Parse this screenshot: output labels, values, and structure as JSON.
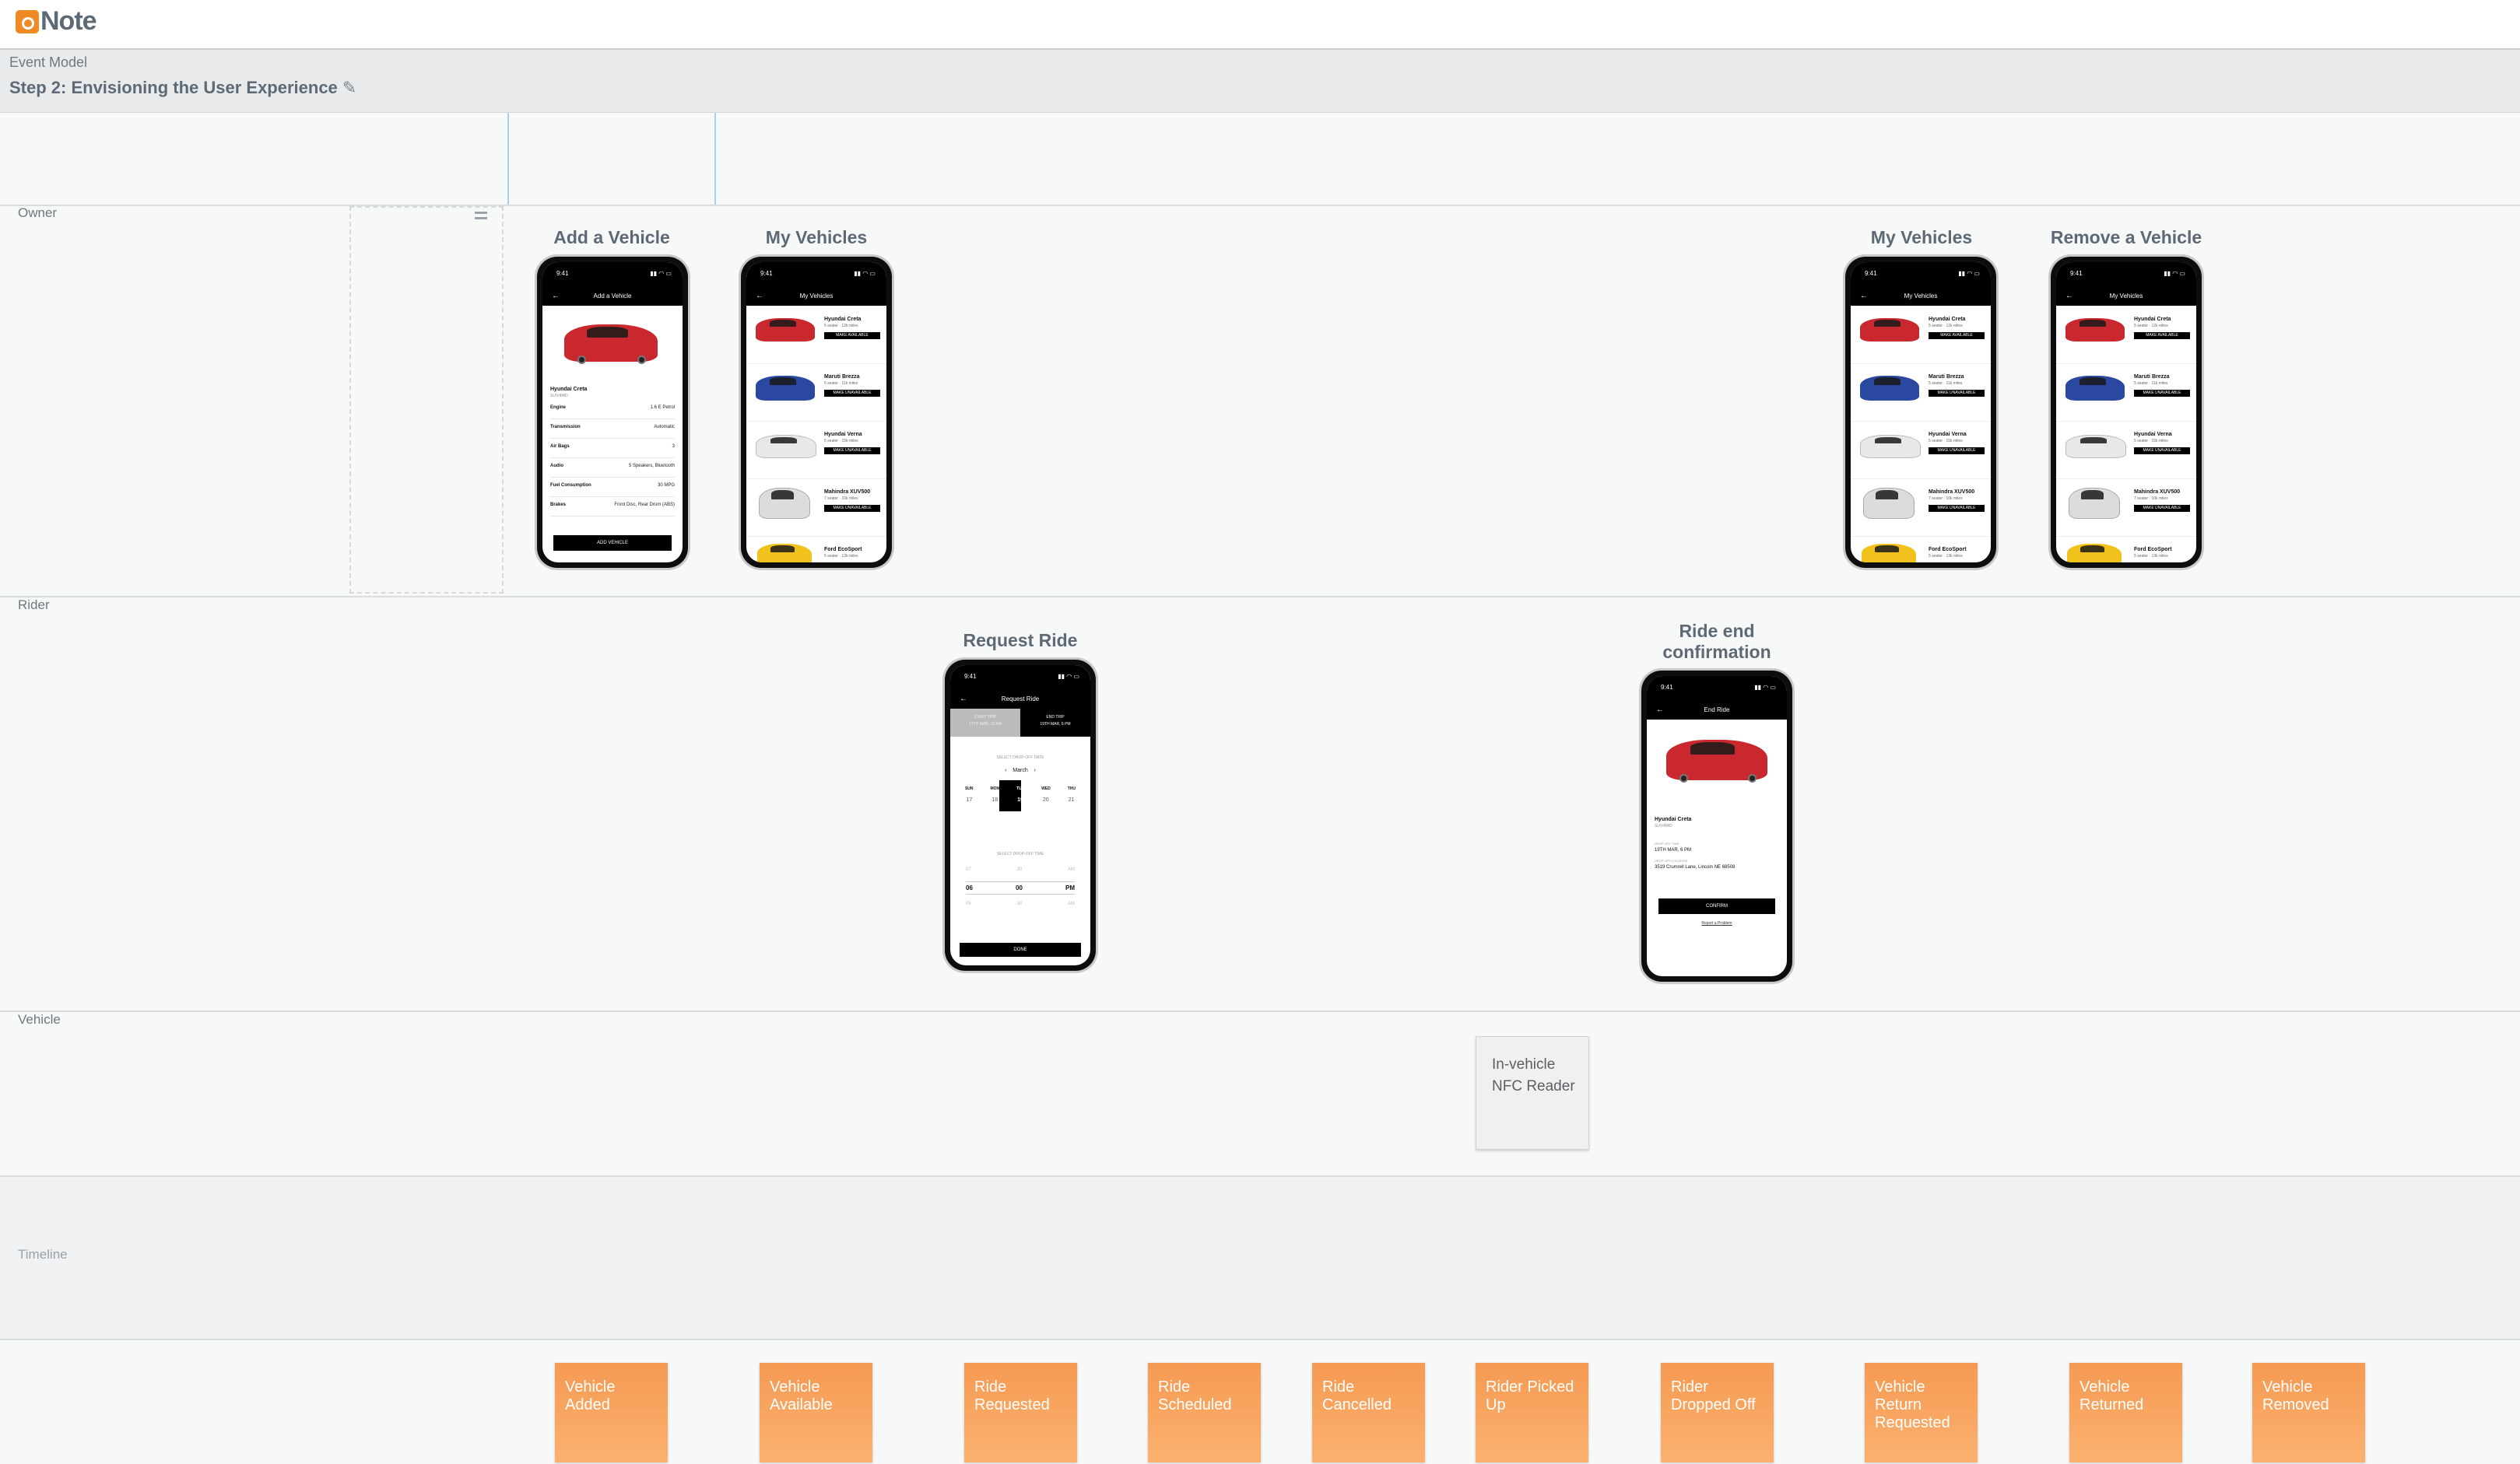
{
  "app": {
    "name": "Note"
  },
  "header": {
    "breadcrumb": "Event Model",
    "title": "Step 2: Envisioning the User Experience"
  },
  "lanes": [
    "Owner",
    "Rider",
    "Vehicle",
    "Timeline"
  ],
  "screens": {
    "add_vehicle": {
      "title": "Add a Vehicle",
      "nav_title": "Add a Vehicle",
      "status_time": "9:41",
      "car_name": "Hyundai Creta",
      "car_sub": "SUV/4WD",
      "specs": [
        {
          "k": "Engine",
          "v": "1.6 E Petrol"
        },
        {
          "k": "Transmission",
          "v": "Automatic"
        },
        {
          "k": "Air Bags",
          "v": "3"
        },
        {
          "k": "Audio",
          "v": "5 Speakers, Bluetooth"
        },
        {
          "k": "Fuel Consumption",
          "v": "30 MPG"
        },
        {
          "k": "Brakes",
          "v": "Front Disc, Rear Drum (ABS)"
        }
      ],
      "button": "ADD VEHICLE"
    },
    "my_vehicles": {
      "title": "My Vehicles",
      "nav_title": "My Vehicles",
      "status_time": "9:41",
      "vehicles": [
        {
          "name": "Hyundai Creta",
          "sub": "5 seater · 12k miles",
          "btn": "MAKE AVAILABLE"
        },
        {
          "name": "Maruti Brezza",
          "sub": "5 seater · 11k miles",
          "btn": "MAKE UNAVAILABLE"
        },
        {
          "name": "Hyundai Verna",
          "sub": "5 seater · 15k miles",
          "btn": "MAKE UNAVAILABLE"
        },
        {
          "name": "Mahindra XUV500",
          "sub": "7 seater · 10k miles",
          "btn": "MAKE UNAVAILABLE"
        },
        {
          "name": "Ford EcoSport",
          "sub": "5 seater · 13k miles",
          "btn": ""
        }
      ]
    },
    "my_vehicles_2": {
      "title": "My Vehicles"
    },
    "remove_vehicle": {
      "title": "Remove a Vehicle"
    },
    "request_ride": {
      "title": "Request Ride",
      "nav_title": "Request Ride",
      "status_time": "9:41",
      "tab_start_label": "START TRIP",
      "tab_start_value": "17TH MAR, 10 AM",
      "tab_end_label": "END TRIP",
      "tab_end_value": "19TH MAR, 6 PM",
      "select_date": "SELECT DROP-OFF DATE",
      "month": "March",
      "days": [
        "SUN",
        "MON",
        "TUE",
        "WED",
        "THU"
      ],
      "dates": [
        "17",
        "18",
        "19",
        "20",
        "21"
      ],
      "select_time": "SELECT DROP-OFF TIME",
      "time_prev": [
        "07",
        "30",
        "AM"
      ],
      "time_sel": [
        "06",
        "00",
        "PM"
      ],
      "time_next": [
        "05",
        "30",
        "AM"
      ],
      "button": "DONE"
    },
    "ride_end": {
      "title": "Ride end confirmation",
      "nav_title": "End Ride",
      "status_time": "9:41",
      "car_name": "Hyundai Creta",
      "car_sub": "SUV/4WD",
      "drop_label": "DROP-OFF TIME",
      "drop_value": "19TH MAR, 6 PM",
      "loc_label": "DROP-OFF LOCATION",
      "loc_value": "3519 Crumrell Lane, Lincoln NE 68508",
      "button": "CONFIRM",
      "link": "Report a Problem"
    }
  },
  "vehicle_lane": {
    "box": "In-vehicle NFC Reader"
  },
  "events": [
    "Vehicle Added",
    "Vehicle Available",
    "Ride Requested",
    "Ride Scheduled",
    "Ride Cancelled",
    "Rider Picked Up",
    "Rider Dropped Off",
    "Vehicle Return Requested",
    "Vehicle Returned",
    "Vehicle Removed"
  ],
  "colors": {
    "event": "#f7a25e",
    "accent": "#f08a24",
    "car_red": "#c8282e",
    "car_blue": "#2a48a0",
    "car_white": "#e8e8e8",
    "car_yellow": "#f1c21b"
  }
}
